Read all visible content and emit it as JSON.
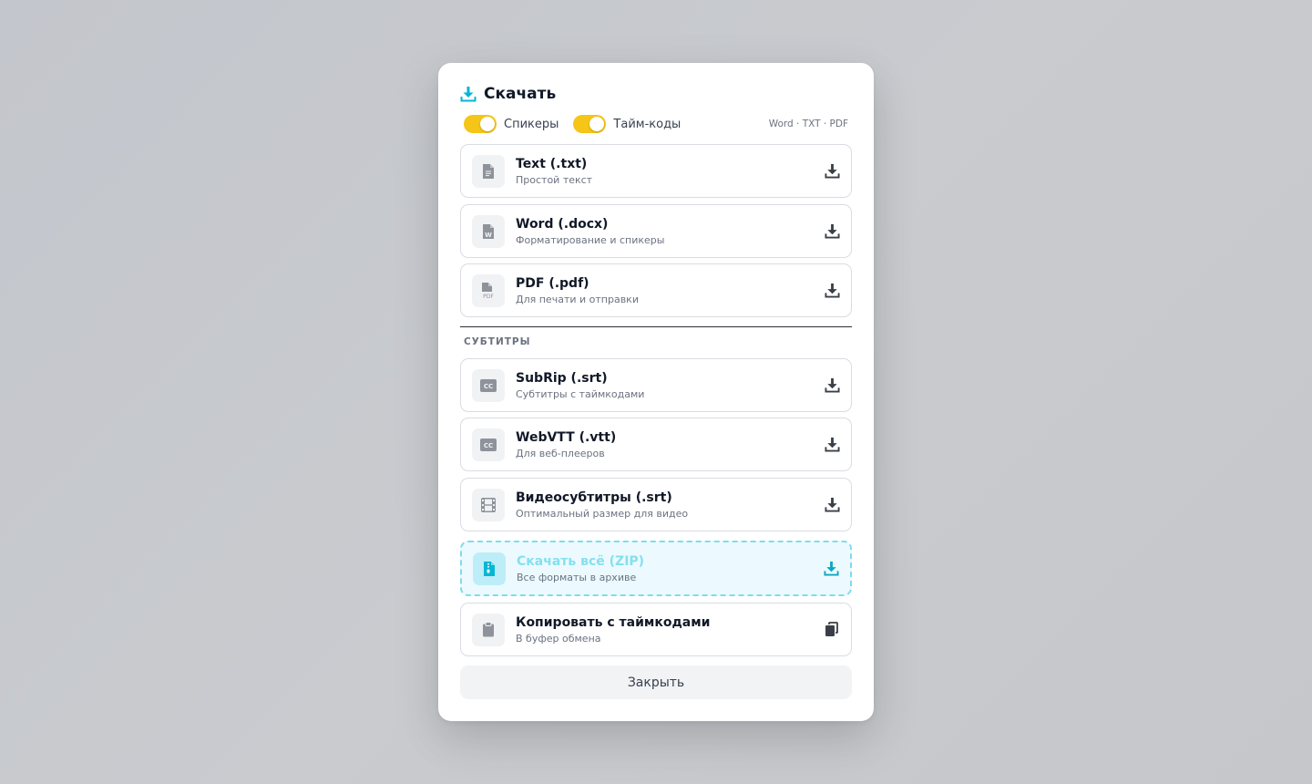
{
  "dialog": {
    "title": "Скачать",
    "icon": "download-icon",
    "accent": "#06b6d4"
  },
  "options": {
    "speakers_label": "Спикеры",
    "speakers_on": true,
    "timecodes_label": "Тайм-коды",
    "timecodes_on": true,
    "formats_hint": "Word · TXT · PDF",
    "toggle_color": "#f5c518"
  },
  "documents": [
    {
      "title": "Text (.txt)",
      "subtitle": "Простой текст",
      "icon": "file-text-icon",
      "action_icon": "download-icon"
    },
    {
      "title": "Word (.docx)",
      "subtitle": "Форматирование и спикеры",
      "icon": "file-word-icon",
      "action_icon": "download-icon"
    },
    {
      "title": "PDF (.pdf)",
      "subtitle": "Для печати и отправки",
      "icon": "file-pdf-icon",
      "action_icon": "download-icon"
    }
  ],
  "subtitles_section": {
    "label": "СУБТИТРЫ",
    "items": [
      {
        "title": "SubRip (.srt)",
        "subtitle": "Субтитры с таймкодами",
        "icon": "closed-captions-icon",
        "action_icon": "download-icon"
      },
      {
        "title": "WebVTT (.vtt)",
        "subtitle": "Для веб-плееров",
        "icon": "closed-captions-icon",
        "action_icon": "download-icon"
      },
      {
        "title": "Видеосубтитры (.srt)",
        "subtitle": "Оптимальный размер для видео",
        "icon": "film-icon",
        "action_icon": "download-icon"
      }
    ]
  },
  "zip": {
    "title": "Скачать всё (ZIP)",
    "subtitle": "Все форматы в архиве",
    "icon": "file-zip-icon",
    "action_icon": "download-icon"
  },
  "copy": {
    "title": "Копировать с таймкодами",
    "subtitle": "В буфер обмена",
    "icon": "clipboard-icon",
    "action_icon": "copy-icon"
  },
  "close_label": "Закрыть"
}
